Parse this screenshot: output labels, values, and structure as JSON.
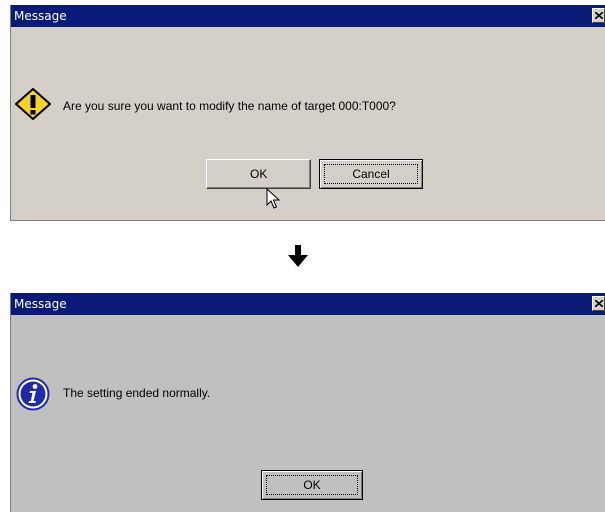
{
  "dialog_confirm": {
    "title": "Message",
    "icon": "warning-icon",
    "message": "Are you sure you want to modify the name of target 000:T000?",
    "ok_label": "OK",
    "cancel_label": "Cancel"
  },
  "transition": {
    "icon": "arrow-down-icon"
  },
  "dialog_result": {
    "title": "Message",
    "icon": "info-icon",
    "message": "The setting ended normally.",
    "ok_label": "OK"
  },
  "colors": {
    "titlebar": "#0a1a78",
    "dialog_bg_1": "#d4d0c8",
    "dialog_bg_2": "#c0c0c0",
    "warning_fill": "#f7d22a",
    "info_fill": "#1f2aa8"
  }
}
